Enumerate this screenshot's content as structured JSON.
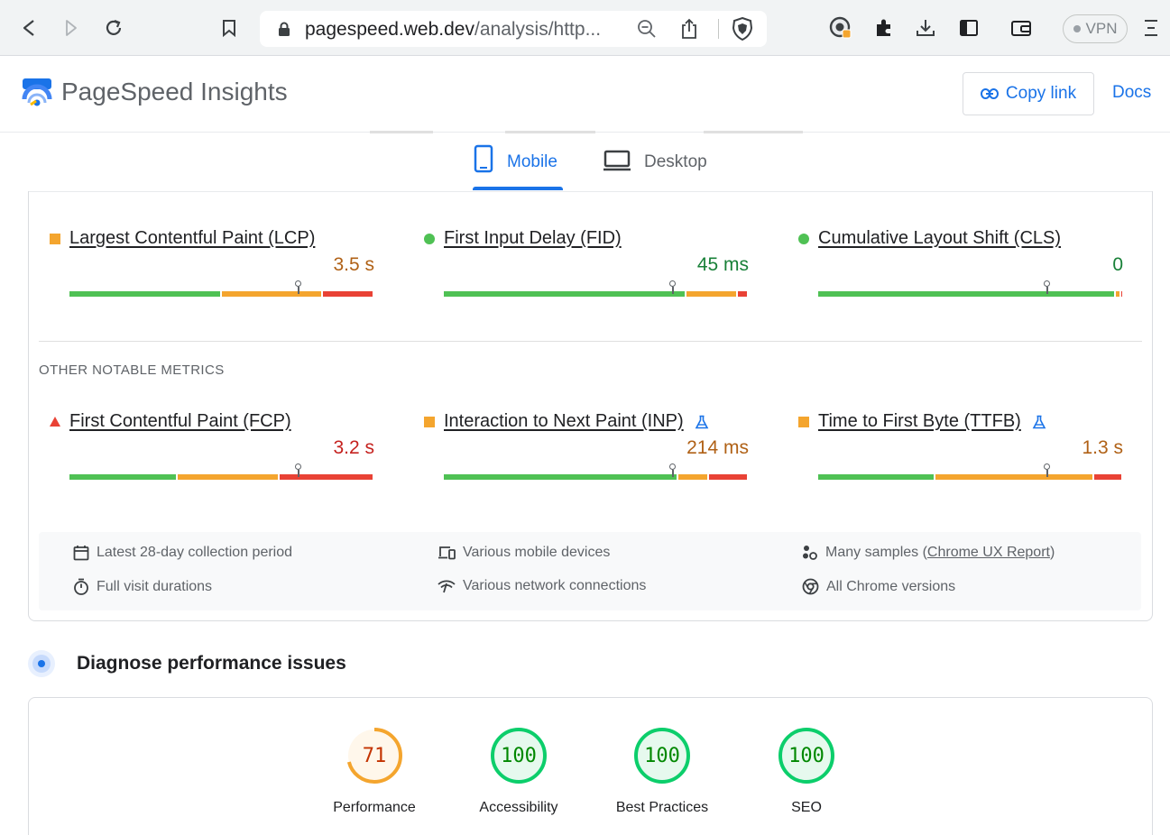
{
  "browser": {
    "url_host": "pagespeed.web.dev",
    "url_path": "/analysis/http...",
    "vpn_label": "VPN"
  },
  "header": {
    "title": "PageSpeed Insights",
    "copy_link": "Copy link",
    "docs": "Docs"
  },
  "tabs": [
    {
      "label": "Mobile",
      "active": true
    },
    {
      "label": "Desktop",
      "active": false
    }
  ],
  "core_metrics": [
    {
      "name": "Largest Contentful Paint (LCP)",
      "value": "3.5 s",
      "status": "orange-square",
      "marker_fraction": 0.75,
      "segments": [
        0.5,
        0.33,
        0.17
      ]
    },
    {
      "name": "First Input Delay (FID)",
      "value": "45 ms",
      "status": "green-circle",
      "marker_fraction": 0.75,
      "segments": [
        0.795,
        0.17,
        0.035
      ]
    },
    {
      "name": "Cumulative Layout Shift (CLS)",
      "value": "0",
      "status": "green-circle",
      "marker_fraction": 0.75,
      "segments": [
        0.975,
        0.018,
        0.007
      ]
    }
  ],
  "other_metrics_label": "OTHER NOTABLE METRICS",
  "other_metrics": [
    {
      "name": "First Contentful Paint (FCP)",
      "value": "3.2 s",
      "status": "red-triangle",
      "experimental": false,
      "marker_fraction": 0.75,
      "segments": [
        0.355,
        0.335,
        0.31
      ]
    },
    {
      "name": "Interaction to Next Paint (INP)",
      "value": "214 ms",
      "status": "orange-square",
      "experimental": true,
      "marker_fraction": 0.75,
      "segments": [
        0.77,
        0.1,
        0.13
      ]
    },
    {
      "name": "Time to First Byte (TTFB)",
      "value": "1.3 s",
      "status": "orange-square",
      "experimental": true,
      "marker_fraction": 0.75,
      "segments": [
        0.385,
        0.52,
        0.095
      ]
    }
  ],
  "info": {
    "period": "Latest 28-day collection period",
    "devices": "Various mobile devices",
    "samples_prefix": "Many samples (",
    "samples_link": "Chrome UX Report",
    "samples_suffix": ")",
    "durations": "Full visit durations",
    "network": "Various network connections",
    "chrome": "All Chrome versions"
  },
  "diagnose_title": "Diagnose performance issues",
  "scores": [
    {
      "label": "Performance",
      "value": "71",
      "fraction": 0.71,
      "color": "#f4a52e",
      "text_color": "#c33300"
    },
    {
      "label": "Accessibility",
      "value": "100",
      "fraction": 1.0,
      "color": "#0cce6b",
      "text_color": "#008800"
    },
    {
      "label": "Best Practices",
      "value": "100",
      "fraction": 1.0,
      "color": "#0cce6b",
      "text_color": "#008800"
    },
    {
      "label": "SEO",
      "value": "100",
      "fraction": 1.0,
      "color": "#0cce6b",
      "text_color": "#008800"
    }
  ],
  "colors": {
    "good": "#0cce6b",
    "bar_good": "#4fc154",
    "bar_avg": "#f4a52e",
    "bar_poor": "#e94235",
    "value_avg": "#b06116",
    "value_good": "#188038",
    "value_poor": "#c5221f",
    "accent": "#1a73e8"
  }
}
